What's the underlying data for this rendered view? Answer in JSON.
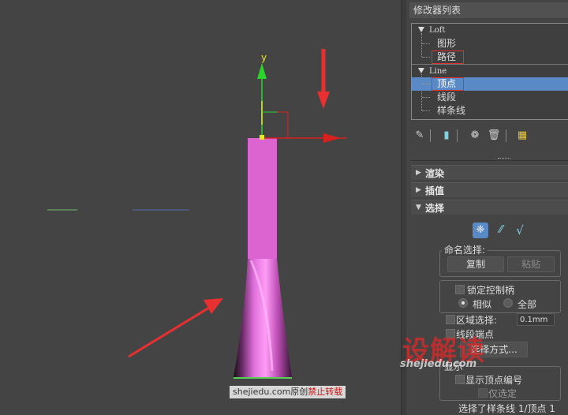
{
  "panel": {
    "modifier_list": "修改器列表",
    "stack": {
      "loft": "Loft",
      "shape": "图形",
      "path": "路径",
      "line": "Line",
      "vertex": "顶点",
      "segment": "线段",
      "spline": "样条线"
    },
    "rollouts": {
      "render": "渲染",
      "interp": "插值",
      "select": "选择"
    },
    "named_sel": {
      "title": "命名选择:",
      "copy": "复制",
      "paste": "粘贴"
    },
    "lock_handles": "锁定控制柄",
    "similar": "相似",
    "all": "全部",
    "area_sel": "区域选择:",
    "area_value": "0.1mm",
    "seg_end": "线段端点",
    "sel_method": "选择方式...",
    "display": "显示",
    "show_vertex_num": "显示顶点编号",
    "only_sel": "仅选定",
    "status": "选择了样条线 1/顶点 1"
  },
  "viewport": {
    "axis_y": "y"
  },
  "watermark": {
    "logo": "设解读",
    "site": "shejiedu.com",
    "badge_site": "shejiedu.com原创",
    "badge_warn": "禁止转载"
  },
  "colors": {
    "selected_row": "#5a8ac6",
    "highlight_red": "#e03030",
    "object_pink": "#e060d0"
  }
}
